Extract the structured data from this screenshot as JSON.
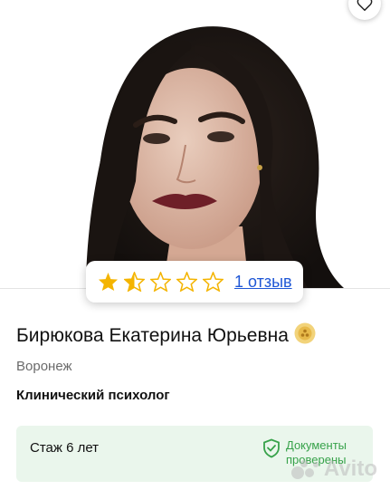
{
  "profile": {
    "rating_value": 1.5,
    "rating_max": 5,
    "reviews_label": "1 отзыв",
    "name": "Бирюкова Екатерина Юрьевна",
    "city": "Воронеж",
    "specialty": "Клинический психолог"
  },
  "experience": {
    "label": "Стаж 6 лет",
    "docs_line1": "Документы",
    "docs_line2": "проверены"
  },
  "watermark": "Avito",
  "colors": {
    "star": "#f4b400",
    "link": "#1f57d6",
    "verified": "#37a24a",
    "exp_bg": "#eaf6ec"
  },
  "icons": [
    "heart-icon",
    "star-icon",
    "medal-badge-icon",
    "shield-check-icon",
    "avito-logo"
  ]
}
